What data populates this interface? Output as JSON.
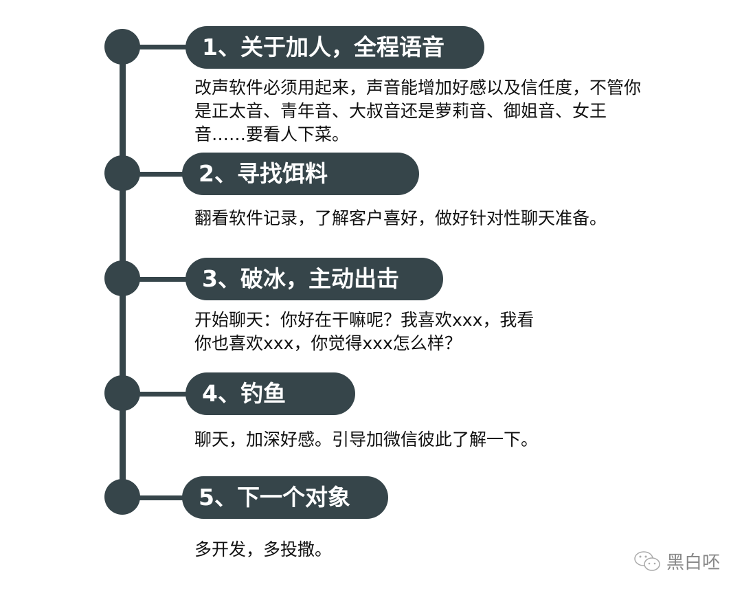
{
  "steps": [
    {
      "title": "1、关于加人，全程语音",
      "lines": [
        "改声软件必须用起来，声音能增加好感以及信任度，不管你",
        "是正太音、青年音、大叔音还是萝莉音、御姐音、女王",
        "音……要看人下菜。"
      ]
    },
    {
      "title": "2、寻找饵料",
      "lines": [
        "翻看软件记录，了解客户喜好，做好针对性聊天准备。"
      ]
    },
    {
      "title": "3、破冰，主动出击",
      "lines": [
        "开始聊天：你好在干嘛呢？我喜欢xxx，我看",
        "你也喜欢xxx，你觉得xxx怎么样？"
      ]
    },
    {
      "title": "4、钓鱼",
      "lines": [
        "聊天，加深好感。引导加微信彼此了解一下。"
      ]
    },
    {
      "title": "5、下一个对象",
      "lines": [
        "多开发，多投撒。"
      ]
    }
  ],
  "watermark": {
    "icon": "wechat-icon",
    "text": "黑白呸"
  },
  "colors": {
    "accent": "#36454a"
  }
}
